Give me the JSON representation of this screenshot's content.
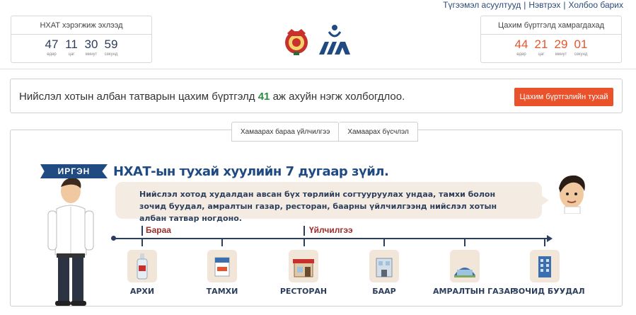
{
  "toplinks": {
    "faq": "Түгээмэл асуултууд",
    "login": "Нэвтрэх",
    "contact": "Холбоо барих",
    "sep": "|"
  },
  "countdown_left": {
    "title": "НХАТ хэрэгжиж эхлээд",
    "values": [
      "47",
      "11",
      "30",
      "59"
    ],
    "units": [
      "өдөр",
      "цаг",
      "минут",
      "секунд"
    ]
  },
  "countdown_right": {
    "title": "Цахим бүртгэлд хамрагдахад",
    "values": [
      "44",
      "21",
      "29",
      "01"
    ],
    "units": [
      "өдөр",
      "цаг",
      "минут",
      "секунд"
    ]
  },
  "infobar": {
    "msg_before": "Нийслэл хотын албан татварын цахим бүртгэлд ",
    "msg_count": "41",
    "msg_after": " аж ахуйн нэгж холбогдлоо.",
    "button": "Цахим бүртгэлийн тухай"
  },
  "tabs": [
    "Хамаарах бараа үйлчилгээ",
    "Хамаарах бүсчлэл"
  ],
  "banner": "ИРГЭН",
  "headline": "НХАТ-ын тухай хуулийн 7 дугаар зүйл.",
  "bubble_text": "Нийслэл хотод худалдан авсан бүх төрлийн согтууруулах ундаа, тамхи болон зочид буудал, амралтын газар, ресторан, баарны үйлчилгээнд нийслэл хотын албан татвар ногдоно.",
  "timeline": {
    "goods": "Бараа",
    "services": "Үйлчилгээ"
  },
  "items": [
    {
      "label": "АРХИ",
      "icon": "vodka-bottle-icon"
    },
    {
      "label": "ТАМХИ",
      "icon": "cigarette-pack-icon"
    },
    {
      "label": "РЕСТОРАН",
      "icon": "restaurant-icon"
    },
    {
      "label": "БААР",
      "icon": "bar-icon"
    },
    {
      "label": "АМРАЛТЫН ГАЗАР",
      "icon": "resort-icon"
    },
    {
      "label": "ЗОЧИД БУУДАЛ",
      "icon": "hotel-icon"
    }
  ],
  "colors": {
    "accent": "#e9522b",
    "navy": "#1f4a82",
    "count_green": "#2e8b3e",
    "count_red": "#e4572e"
  }
}
